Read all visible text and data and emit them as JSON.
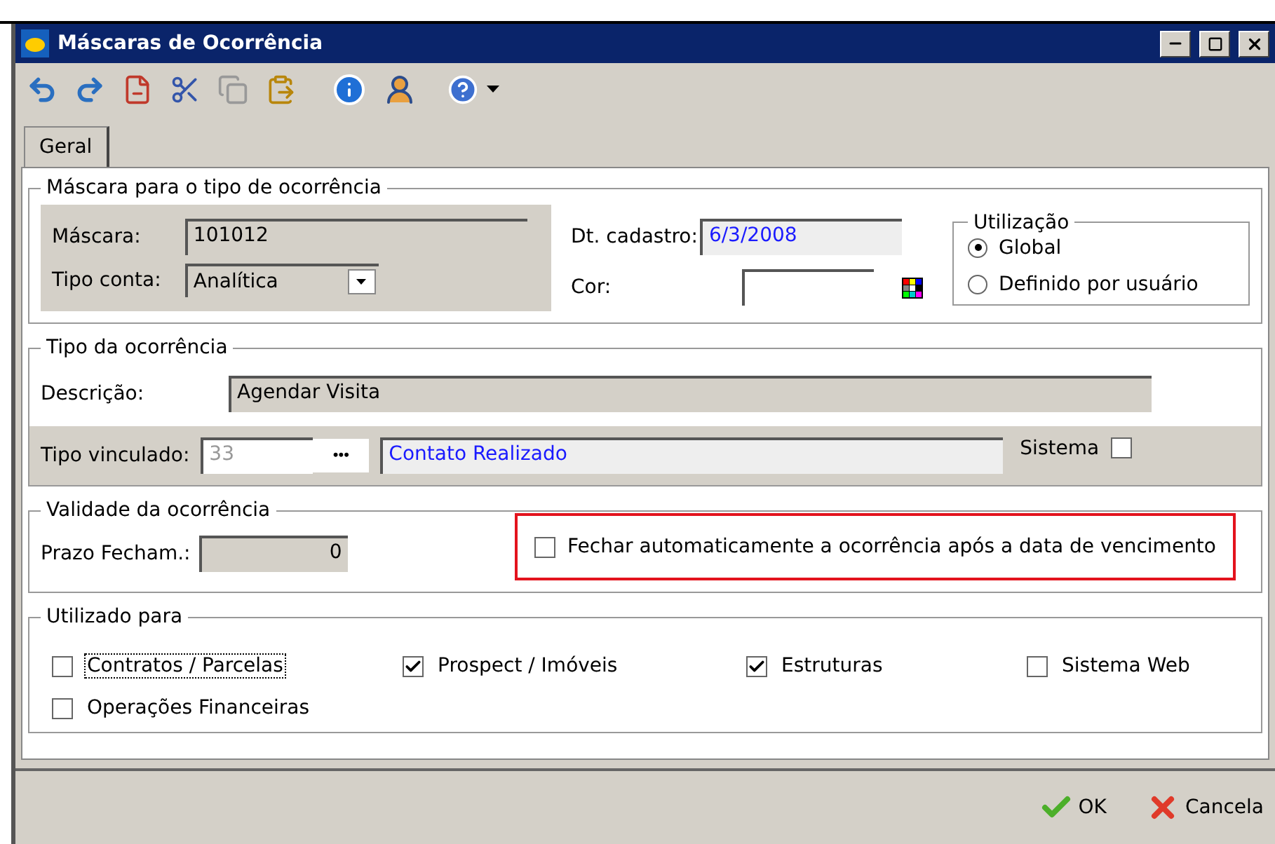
{
  "window": {
    "title": "Máscaras de Ocorrência"
  },
  "tabs": [
    {
      "label": "Geral",
      "selected": true
    }
  ],
  "mask_group": {
    "title": "Máscara para o tipo de ocorrência",
    "mask_label": "Máscara:",
    "mask_value": "101012",
    "account_type_label": "Tipo conta:",
    "account_type_value": "Analítica",
    "registered_label": "Dt. cadastro:",
    "registered_value": "6/3/2008",
    "color_label": "Cor:"
  },
  "usage": {
    "title": "Utilização",
    "options": [
      {
        "label": "Global",
        "selected": true
      },
      {
        "label": "Definido por usuário",
        "selected": false
      }
    ]
  },
  "occurrence_type": {
    "title": "Tipo da ocorrência",
    "description_label": "Descrição:",
    "description_value": "Agendar Visita",
    "linked_label": "Tipo vinculado:",
    "linked_code": "33",
    "linked_button": "•••",
    "linked_name": "Contato Realizado",
    "system_label": "Sistema",
    "system_checked": false
  },
  "validity": {
    "title": "Validade da ocorrência",
    "deadline_label": "Prazo Fecham.:",
    "deadline_value": "0",
    "auto_close": {
      "label": "Fechar automaticamente a ocorrência após a data de vencimento",
      "checked": false,
      "highlighted": true
    }
  },
  "used_for": {
    "title": "Utilizado para",
    "options": [
      {
        "label": "Contratos / Parcelas",
        "checked": false,
        "focused": true
      },
      {
        "label": "Prospect / Imóveis",
        "checked": true,
        "focused": false
      },
      {
        "label": "Estruturas",
        "checked": true,
        "focused": false
      },
      {
        "label": "Sistema Web",
        "checked": false,
        "focused": false
      },
      {
        "label": "Operações Financeiras",
        "checked": false,
        "focused": false
      }
    ]
  },
  "buttons": [
    {
      "kind": "ok",
      "label": "OK"
    },
    {
      "kind": "cancel",
      "label": "Cancela"
    }
  ]
}
